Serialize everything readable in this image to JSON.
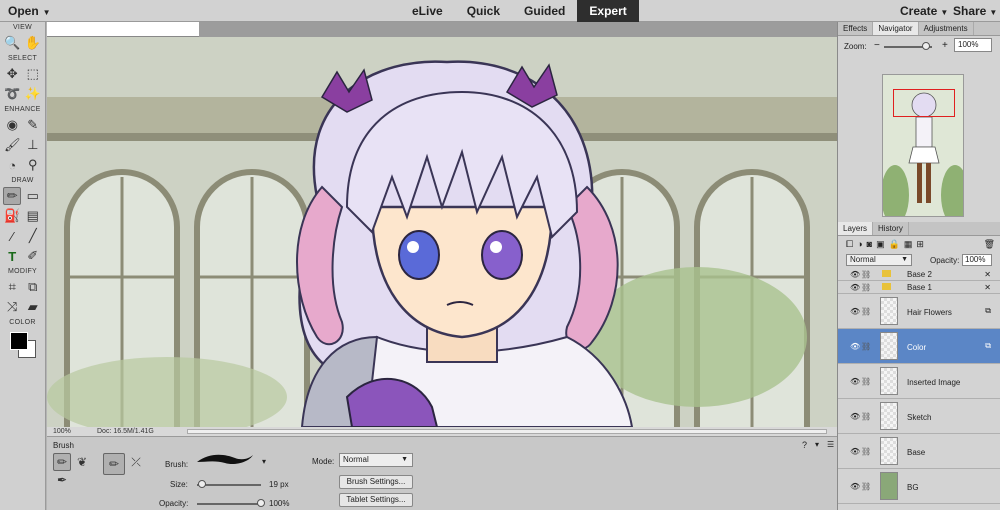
{
  "topbar": {
    "open_label": "Open",
    "modes": [
      "eLive",
      "Quick",
      "Guided",
      "Expert"
    ],
    "active_mode": "Expert",
    "create_label": "Create",
    "share_label": "Share"
  },
  "toolbar": {
    "sections": [
      "VIEW",
      "SELECT",
      "ENHANCE",
      "DRAW",
      "MODIFY",
      "COLOR"
    ]
  },
  "status": {
    "zoom": "100%",
    "doc": "Doc: 16.5M/1.41G"
  },
  "panels": {
    "top_tabs": [
      "Effects",
      "Navigator",
      "Adjustments"
    ],
    "top_active": "Navigator",
    "zoom_label": "Zoom:",
    "zoom_value": "100%",
    "layer_tabs": [
      "Layers",
      "History"
    ],
    "layer_active": "Layers",
    "blend_mode": "Normal",
    "opacity_label": "Opacity:",
    "opacity_value": "100%"
  },
  "layers": [
    {
      "name": "Base 2",
      "type": "group"
    },
    {
      "name": "Base 1",
      "type": "group"
    },
    {
      "name": "Hair Flowers",
      "type": "layer"
    },
    {
      "name": "Color",
      "type": "layer",
      "selected": true
    },
    {
      "name": "Inserted Image",
      "type": "layer"
    },
    {
      "name": "Sketch",
      "type": "layer"
    },
    {
      "name": "Base",
      "type": "layer"
    },
    {
      "name": "BG",
      "type": "layer"
    }
  ],
  "options": {
    "title": "Brush",
    "brush_label": "Brush:",
    "size_label": "Size:",
    "size_value": "19 px",
    "opacity_label": "Opacity:",
    "opacity_value": "100%",
    "mode_label": "Mode:",
    "mode_value": "Normal",
    "brush_settings": "Brush Settings...",
    "tablet_settings": "Tablet Settings..."
  },
  "colors": {
    "foreground": "#000000",
    "background": "#ffffff",
    "selected_layer": "#5b86c6",
    "active_mode_bg": "#2e2e2e"
  }
}
